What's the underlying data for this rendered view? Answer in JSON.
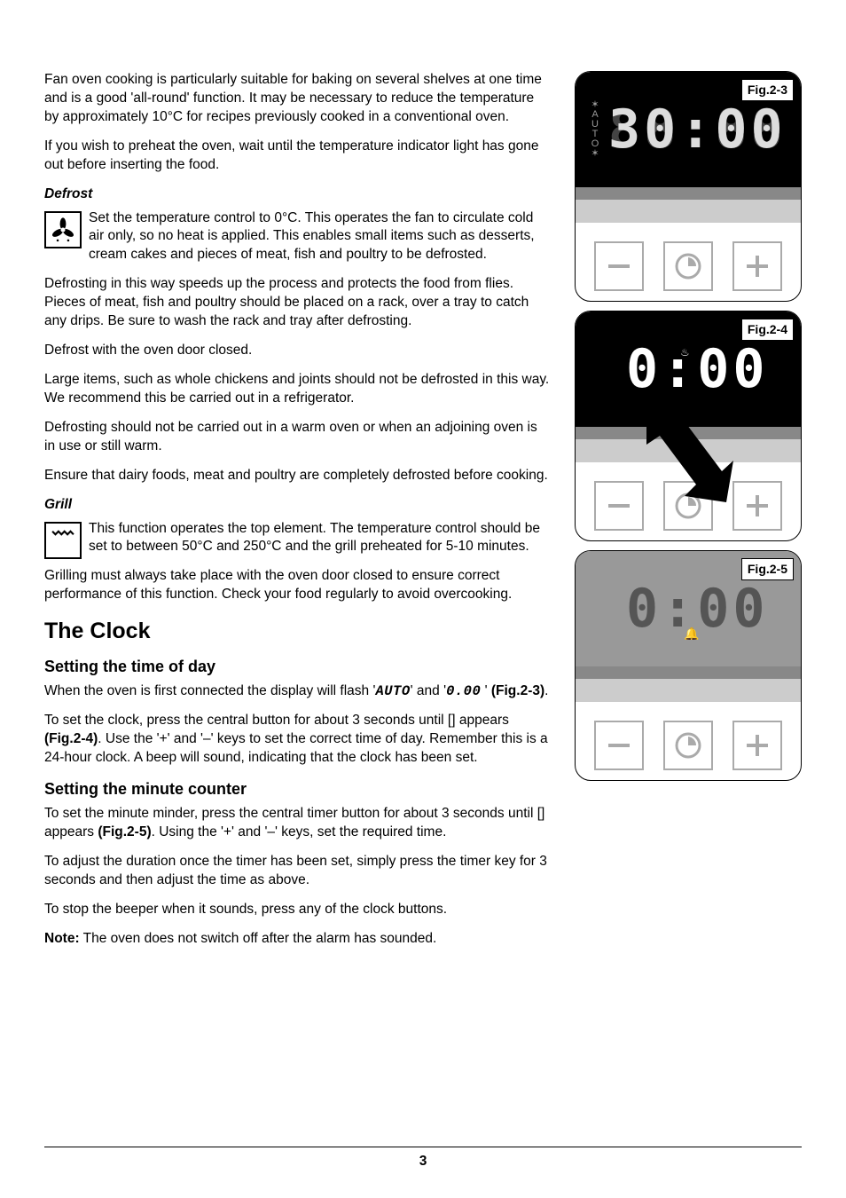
{
  "intro": {
    "p1": "Fan oven cooking is particularly suitable for baking on several shelves at one time and is a good 'all-round' function. It may be necessary to reduce the temperature by approximately 10°C for recipes previously cooked in a conventional oven.",
    "p2": "If you wish to preheat the oven, wait until the temperature indicator light has gone out before inserting the food."
  },
  "defrost": {
    "heading": "Defrost",
    "p1": "Set the temperature control to 0°C. This operates the fan to circulate cold air only, so no heat is applied. This enables small items such as desserts, cream cakes and pieces of meat, fish and poultry to be defrosted.",
    "p2": "Defrosting in this way speeds up the process and protects the food from flies. Pieces of meat, fish and poultry should be placed on a rack, over a tray to catch any drips. Be sure to wash the rack and tray after defrosting.",
    "p3": "Defrost with the oven door closed.",
    "p4": "Large items, such as whole chickens and joints should not be defrosted in this way. We recommend this be carried out in a refrigerator.",
    "p5": "Defrosting should not be carried out in a warm oven or when an adjoining oven is in use or still warm.",
    "p6": "Ensure that dairy foods, meat and poultry are completely defrosted before cooking."
  },
  "grill": {
    "heading": "Grill",
    "p1": "This function operates the top element. The temperature control should be set to between 50°C and 250°C and the grill preheated for 5-10 minutes.",
    "p2": "Grilling must always take place with the oven door closed to ensure correct performance of this function. Check your food regularly to avoid overcooking."
  },
  "clock": {
    "heading": "The Clock",
    "set_time_heading": "Setting the time of day",
    "p1a": "When the oven is first connected the display will flash '",
    "auto_text": "AUTO",
    "p1b": "' and '",
    "time_text": "0.00",
    "p1c": " ' ",
    "fig23": "(Fig.2-3)",
    "p1d": ".",
    "p2a": "To set the clock, press the central button for about 3 seconds until [] appears ",
    "fig24": "(Fig.2-4)",
    "p2b": ". Use the '+' and '–' keys to set the correct time of day. Remember this is a 24-hour clock. A beep will sound, indicating that the clock has been set.",
    "set_min_heading": "Setting the minute counter",
    "p3a": "To set the minute minder, press the central timer button for about 3 seconds until [] appears ",
    "fig25": "(Fig.2-5)",
    "p3b": ". Using the '+' and '–' keys, set the required time.",
    "p4": "To adjust the duration once the timer has been set, simply press the timer key for 3 seconds and then adjust the time as above.",
    "p5": "To stop the beeper when it sounds, press any of the clock buttons.",
    "note_label": "Note:",
    "note_text": " The oven does not switch off after the alarm has sounded."
  },
  "figures": {
    "f23": {
      "label": "Fig.2-3",
      "display": "30:00"
    },
    "f24": {
      "label": "Fig.2-4",
      "display": "0:00"
    },
    "f25": {
      "label": "Fig.2-5",
      "display": "0:00"
    }
  },
  "icons": {
    "defrost": "defrost-fan-icon",
    "grill": "grill-element-icon",
    "minus": "−",
    "plus": "+"
  },
  "page_number": "3"
}
